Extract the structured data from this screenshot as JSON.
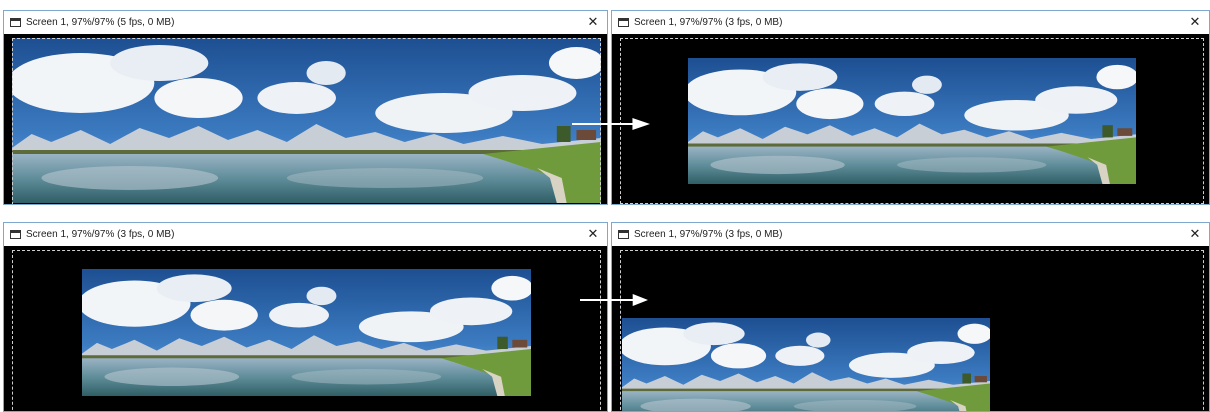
{
  "windows": [
    {
      "title": "Screen 1, 97%/97% (5 fps, 0 MB)",
      "close": "✕"
    },
    {
      "title": "Screen 1, 97%/97% (3 fps, 0 MB)",
      "close": "✕"
    },
    {
      "title": "Screen 1, 97%/97% (3 fps, 0 MB)",
      "close": "✕"
    },
    {
      "title": "Screen 1, 97%/97% (3 fps, 0 MB)",
      "close": "✕"
    }
  ],
  "colors": {
    "window_border": "#7fa8cf",
    "sky": "#2f6bb0",
    "water": "#5a8a96",
    "grass": "#6f9b3c"
  }
}
